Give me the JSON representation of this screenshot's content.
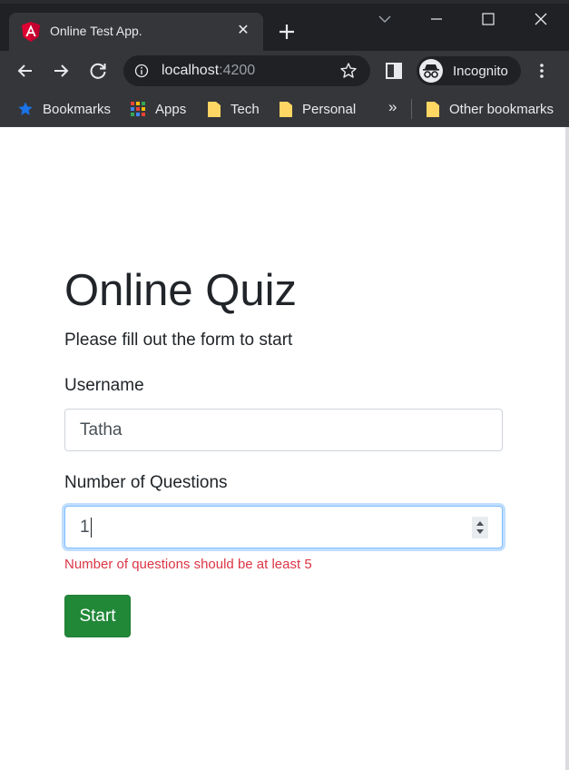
{
  "browser": {
    "tab_title": "Online Test App.",
    "url_host": "localhost",
    "url_port": ":4200",
    "profile_label": "Incognito",
    "bookmarks": [
      {
        "label": "Bookmarks",
        "icon": "star-icon"
      },
      {
        "label": "Apps",
        "icon": "apps-grid-icon"
      },
      {
        "label": "Tech",
        "icon": "folder-icon"
      },
      {
        "label": "Personal",
        "icon": "folder-icon"
      }
    ],
    "more_bookmarks": "»",
    "other_bookmarks": "Other bookmarks"
  },
  "page": {
    "title": "Online Quiz",
    "subtitle": "Please fill out the form to start",
    "form": {
      "username_label": "Username",
      "username_value": "Tatha",
      "questions_label": "Number of Questions",
      "questions_value": "1",
      "error_message": "Number of questions should be at least 5",
      "submit_label": "Start"
    }
  },
  "colors": {
    "chrome_dark": "#202124",
    "chrome_toolbar": "#35363a",
    "submit_green": "#218838",
    "error_red": "#dc3545",
    "focus_blue": "#80bdff"
  }
}
